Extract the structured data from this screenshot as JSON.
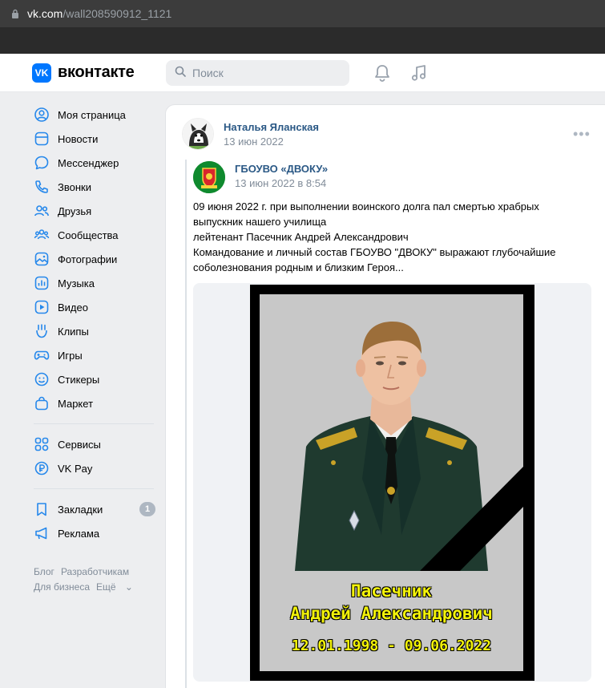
{
  "browser": {
    "url_host": "vk.com",
    "url_path": "/wall208590912_1121"
  },
  "header": {
    "brand": "вконтакте",
    "search_placeholder": "Поиск"
  },
  "menu": {
    "items": [
      {
        "label": "Моя страница",
        "icon": "user-circle-icon"
      },
      {
        "label": "Новости",
        "icon": "newsfeed-icon"
      },
      {
        "label": "Мессенджер",
        "icon": "message-icon"
      },
      {
        "label": "Звонки",
        "icon": "phone-icon"
      },
      {
        "label": "Друзья",
        "icon": "friends-icon"
      },
      {
        "label": "Сообщества",
        "icon": "communities-icon"
      },
      {
        "label": "Фотографии",
        "icon": "photo-icon"
      },
      {
        "label": "Музыка",
        "icon": "music-icon"
      },
      {
        "label": "Видео",
        "icon": "video-icon"
      },
      {
        "label": "Клипы",
        "icon": "clips-icon"
      },
      {
        "label": "Игры",
        "icon": "gamepad-icon"
      },
      {
        "label": "Стикеры",
        "icon": "sticker-icon"
      },
      {
        "label": "Маркет",
        "icon": "market-icon"
      }
    ],
    "services": [
      {
        "label": "Сервисы",
        "icon": "services-icon"
      },
      {
        "label": "VK Pay",
        "icon": "vkpay-icon"
      }
    ],
    "extra": [
      {
        "label": "Закладки",
        "icon": "bookmark-icon",
        "badge": "1"
      },
      {
        "label": "Реклама",
        "icon": "megaphone-icon"
      }
    ]
  },
  "footer": {
    "links": [
      "Блог",
      "Разработчикам",
      "Для бизнеса",
      "Ещё"
    ]
  },
  "post": {
    "author": "Наталья Яланская",
    "date": "13 июн 2022",
    "repost": {
      "source": "ГБОУВО «ДВОКУ»",
      "date": "13 июн 2022 в 8:54",
      "text_lines": [
        "09 июня 2022 г. при выполнении воинского долга пал смертью храбрых",
        "выпускник нашего училища",
        "лейтенант Пасечник Андрей Александрович",
        "Командование и личный состав ГБОУВО \"ДВОКУ\" выражают глубочайшие",
        "соболезнования родным и близким Героя..."
      ]
    },
    "photo_caption": {
      "surname": "Пасечник",
      "name": "Андрей Александрович",
      "dates": "12.01.1998 - 09.06.2022"
    }
  },
  "colors": {
    "vk_blue": "#0077ff",
    "link": "#2a5885",
    "muted": "#818c99",
    "menu_icon": "#2688eb",
    "caption_yellow": "#f2f20a"
  }
}
